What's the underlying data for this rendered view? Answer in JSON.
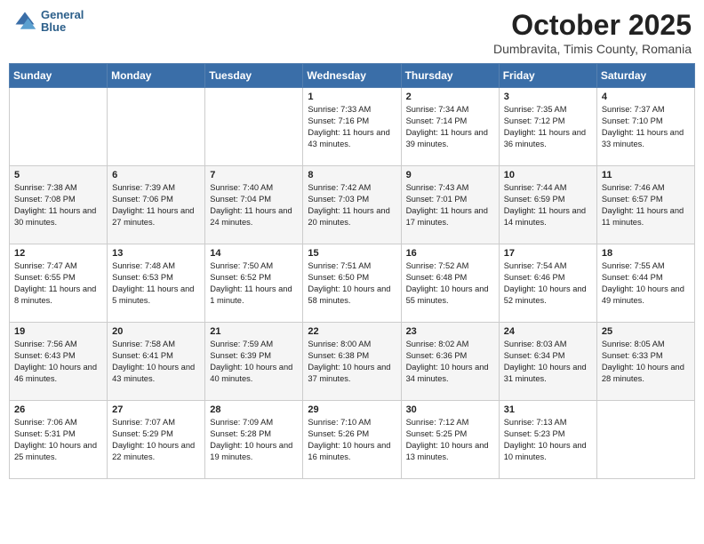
{
  "logo": {
    "line1": "General",
    "line2": "Blue"
  },
  "title": "October 2025",
  "subtitle": "Dumbravita, Timis County, Romania",
  "weekdays": [
    "Sunday",
    "Monday",
    "Tuesday",
    "Wednesday",
    "Thursday",
    "Friday",
    "Saturday"
  ],
  "weeks": [
    [
      {
        "day": "",
        "sunrise": "",
        "sunset": "",
        "daylight": ""
      },
      {
        "day": "",
        "sunrise": "",
        "sunset": "",
        "daylight": ""
      },
      {
        "day": "",
        "sunrise": "",
        "sunset": "",
        "daylight": ""
      },
      {
        "day": "1",
        "sunrise": "Sunrise: 7:33 AM",
        "sunset": "Sunset: 7:16 PM",
        "daylight": "Daylight: 11 hours and 43 minutes."
      },
      {
        "day": "2",
        "sunrise": "Sunrise: 7:34 AM",
        "sunset": "Sunset: 7:14 PM",
        "daylight": "Daylight: 11 hours and 39 minutes."
      },
      {
        "day": "3",
        "sunrise": "Sunrise: 7:35 AM",
        "sunset": "Sunset: 7:12 PM",
        "daylight": "Daylight: 11 hours and 36 minutes."
      },
      {
        "day": "4",
        "sunrise": "Sunrise: 7:37 AM",
        "sunset": "Sunset: 7:10 PM",
        "daylight": "Daylight: 11 hours and 33 minutes."
      }
    ],
    [
      {
        "day": "5",
        "sunrise": "Sunrise: 7:38 AM",
        "sunset": "Sunset: 7:08 PM",
        "daylight": "Daylight: 11 hours and 30 minutes."
      },
      {
        "day": "6",
        "sunrise": "Sunrise: 7:39 AM",
        "sunset": "Sunset: 7:06 PM",
        "daylight": "Daylight: 11 hours and 27 minutes."
      },
      {
        "day": "7",
        "sunrise": "Sunrise: 7:40 AM",
        "sunset": "Sunset: 7:04 PM",
        "daylight": "Daylight: 11 hours and 24 minutes."
      },
      {
        "day": "8",
        "sunrise": "Sunrise: 7:42 AM",
        "sunset": "Sunset: 7:03 PM",
        "daylight": "Daylight: 11 hours and 20 minutes."
      },
      {
        "day": "9",
        "sunrise": "Sunrise: 7:43 AM",
        "sunset": "Sunset: 7:01 PM",
        "daylight": "Daylight: 11 hours and 17 minutes."
      },
      {
        "day": "10",
        "sunrise": "Sunrise: 7:44 AM",
        "sunset": "Sunset: 6:59 PM",
        "daylight": "Daylight: 11 hours and 14 minutes."
      },
      {
        "day": "11",
        "sunrise": "Sunrise: 7:46 AM",
        "sunset": "Sunset: 6:57 PM",
        "daylight": "Daylight: 11 hours and 11 minutes."
      }
    ],
    [
      {
        "day": "12",
        "sunrise": "Sunrise: 7:47 AM",
        "sunset": "Sunset: 6:55 PM",
        "daylight": "Daylight: 11 hours and 8 minutes."
      },
      {
        "day": "13",
        "sunrise": "Sunrise: 7:48 AM",
        "sunset": "Sunset: 6:53 PM",
        "daylight": "Daylight: 11 hours and 5 minutes."
      },
      {
        "day": "14",
        "sunrise": "Sunrise: 7:50 AM",
        "sunset": "Sunset: 6:52 PM",
        "daylight": "Daylight: 11 hours and 1 minute."
      },
      {
        "day": "15",
        "sunrise": "Sunrise: 7:51 AM",
        "sunset": "Sunset: 6:50 PM",
        "daylight": "Daylight: 10 hours and 58 minutes."
      },
      {
        "day": "16",
        "sunrise": "Sunrise: 7:52 AM",
        "sunset": "Sunset: 6:48 PM",
        "daylight": "Daylight: 10 hours and 55 minutes."
      },
      {
        "day": "17",
        "sunrise": "Sunrise: 7:54 AM",
        "sunset": "Sunset: 6:46 PM",
        "daylight": "Daylight: 10 hours and 52 minutes."
      },
      {
        "day": "18",
        "sunrise": "Sunrise: 7:55 AM",
        "sunset": "Sunset: 6:44 PM",
        "daylight": "Daylight: 10 hours and 49 minutes."
      }
    ],
    [
      {
        "day": "19",
        "sunrise": "Sunrise: 7:56 AM",
        "sunset": "Sunset: 6:43 PM",
        "daylight": "Daylight: 10 hours and 46 minutes."
      },
      {
        "day": "20",
        "sunrise": "Sunrise: 7:58 AM",
        "sunset": "Sunset: 6:41 PM",
        "daylight": "Daylight: 10 hours and 43 minutes."
      },
      {
        "day": "21",
        "sunrise": "Sunrise: 7:59 AM",
        "sunset": "Sunset: 6:39 PM",
        "daylight": "Daylight: 10 hours and 40 minutes."
      },
      {
        "day": "22",
        "sunrise": "Sunrise: 8:00 AM",
        "sunset": "Sunset: 6:38 PM",
        "daylight": "Daylight: 10 hours and 37 minutes."
      },
      {
        "day": "23",
        "sunrise": "Sunrise: 8:02 AM",
        "sunset": "Sunset: 6:36 PM",
        "daylight": "Daylight: 10 hours and 34 minutes."
      },
      {
        "day": "24",
        "sunrise": "Sunrise: 8:03 AM",
        "sunset": "Sunset: 6:34 PM",
        "daylight": "Daylight: 10 hours and 31 minutes."
      },
      {
        "day": "25",
        "sunrise": "Sunrise: 8:05 AM",
        "sunset": "Sunset: 6:33 PM",
        "daylight": "Daylight: 10 hours and 28 minutes."
      }
    ],
    [
      {
        "day": "26",
        "sunrise": "Sunrise: 7:06 AM",
        "sunset": "Sunset: 5:31 PM",
        "daylight": "Daylight: 10 hours and 25 minutes."
      },
      {
        "day": "27",
        "sunrise": "Sunrise: 7:07 AM",
        "sunset": "Sunset: 5:29 PM",
        "daylight": "Daylight: 10 hours and 22 minutes."
      },
      {
        "day": "28",
        "sunrise": "Sunrise: 7:09 AM",
        "sunset": "Sunset: 5:28 PM",
        "daylight": "Daylight: 10 hours and 19 minutes."
      },
      {
        "day": "29",
        "sunrise": "Sunrise: 7:10 AM",
        "sunset": "Sunset: 5:26 PM",
        "daylight": "Daylight: 10 hours and 16 minutes."
      },
      {
        "day": "30",
        "sunrise": "Sunrise: 7:12 AM",
        "sunset": "Sunset: 5:25 PM",
        "daylight": "Daylight: 10 hours and 13 minutes."
      },
      {
        "day": "31",
        "sunrise": "Sunrise: 7:13 AM",
        "sunset": "Sunset: 5:23 PM",
        "daylight": "Daylight: 10 hours and 10 minutes."
      },
      {
        "day": "",
        "sunrise": "",
        "sunset": "",
        "daylight": ""
      }
    ]
  ]
}
